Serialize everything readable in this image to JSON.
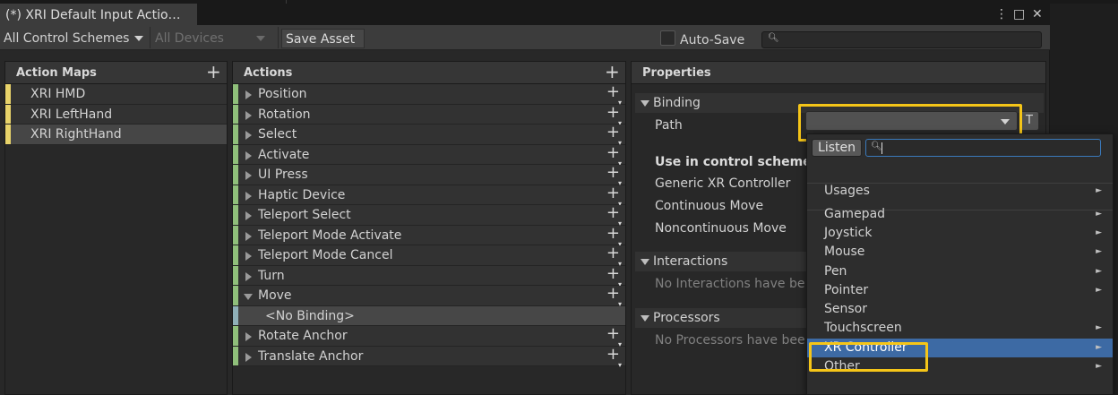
{
  "window": {
    "tab_title": "(*) XRI Default Input Actio…",
    "menu_icon": "⋮",
    "maximize_icon": "□",
    "close_icon": "✕"
  },
  "toolbar": {
    "control_schemes": "All Control Schemes",
    "devices": "All Devices",
    "save_asset": "Save Asset",
    "auto_save": "Auto-Save",
    "search_value": ""
  },
  "action_maps": {
    "header": "Action Maps",
    "items": [
      "XRI HMD",
      "XRI LeftHand",
      "XRI RightHand"
    ],
    "selected_index": 2
  },
  "actions": {
    "header": "Actions",
    "items": [
      {
        "label": "Position"
      },
      {
        "label": "Rotation"
      },
      {
        "label": "Select"
      },
      {
        "label": "Activate"
      },
      {
        "label": "UI Press"
      },
      {
        "label": "Haptic Device"
      },
      {
        "label": "Teleport Select"
      },
      {
        "label": "Teleport Mode Activate"
      },
      {
        "label": "Teleport Mode Cancel"
      },
      {
        "label": "Turn"
      },
      {
        "label": "Move"
      },
      {
        "label": "<No Binding>"
      },
      {
        "label": "Rotate Anchor"
      },
      {
        "label": "Translate Anchor"
      }
    ]
  },
  "properties": {
    "header": "Properties",
    "binding_section": "Binding",
    "path_label": "Path",
    "path_value": "",
    "t_button": "T",
    "use_in_control_scheme": "Use in control scheme",
    "schemes": [
      "Generic XR Controller",
      "Continuous Move",
      "Noncontinuous Move"
    ],
    "interactions_section": "Interactions",
    "interactions_empty": "No Interactions have be",
    "processors_section": "Processors",
    "processors_empty": "No Processors have bee"
  },
  "path_popup": {
    "listen": "Listen",
    "search_value": "",
    "items": [
      "Usages",
      "Gamepad",
      "Joystick",
      "Mouse",
      "Pen",
      "Pointer",
      "Sensor",
      "Touchscreen",
      "XR Controller",
      "Other"
    ],
    "highlighted": "XR Controller"
  },
  "colors": {
    "highlight_box": "#f5c518",
    "menu_hover": "#3d6aa4",
    "action_map_stripe": "#e8d36a",
    "action_stripe": "#8fbf7a"
  }
}
